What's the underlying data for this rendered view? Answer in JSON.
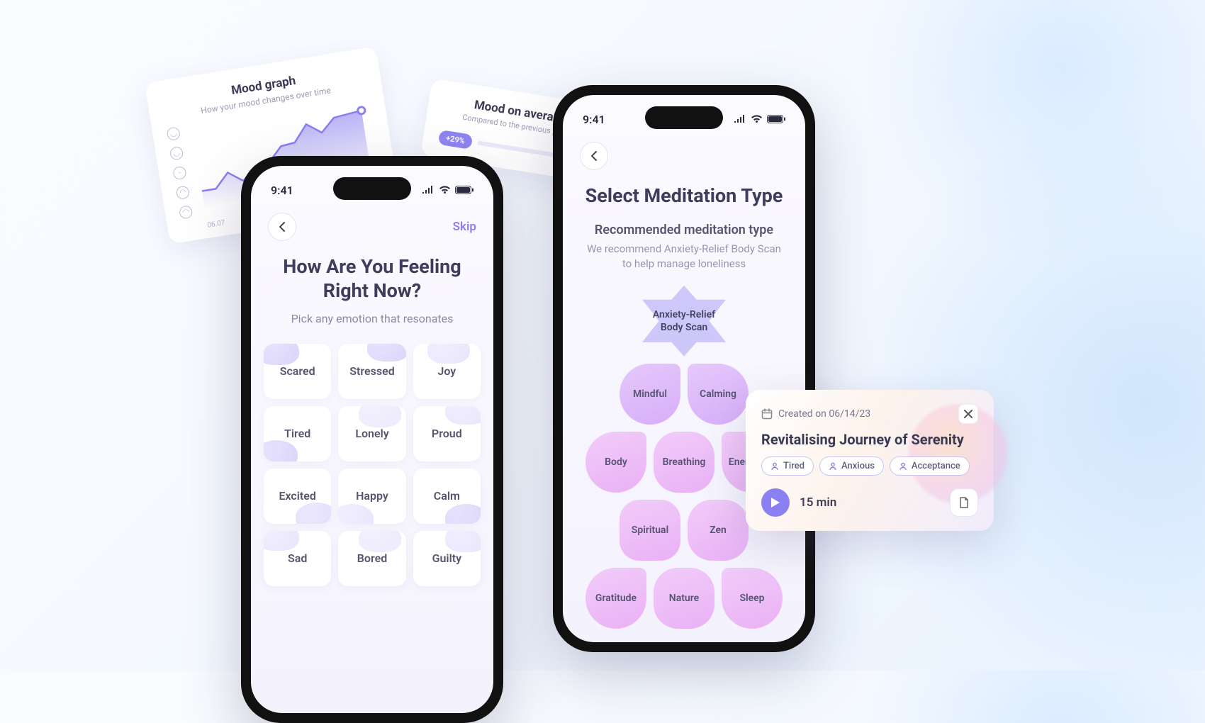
{
  "statusBar": {
    "time": "9:41"
  },
  "moodGraphCard": {
    "title": "Mood graph",
    "subtitle": "How your mood changes over time",
    "startDate": "06.07"
  },
  "moodAvgCard": {
    "title": "Mood on average",
    "subtitle": "Compared to the previous period",
    "delta": "+29%"
  },
  "phoneLeft": {
    "skip": "Skip",
    "heading": "How Are You Feeling Right Now?",
    "subtitle": "Pick any emotion that resonates",
    "emotions": {
      "e0": "Scared",
      "e1": "Stressed",
      "e2": "Joy",
      "e3": "Tired",
      "e4": "Lonely",
      "e5": "Proud",
      "e6": "Excited",
      "e7": "Happy",
      "e8": "Calm",
      "e9": "Sad",
      "e10": "Bored",
      "e11": "Guilty"
    }
  },
  "phoneRight": {
    "heading": "Select Meditation Type",
    "recommendLabel": "Recommended meditation type",
    "recommendDesc": "We recommend Anxiety-Relief Body Scan to help manage loneliness",
    "recommended": "Anxiety-Relief Body Scan",
    "types": {
      "t0": "Mindful",
      "t1": "Calming",
      "t2": "Body",
      "t3": "Breathing",
      "t4": "Energising",
      "t5": "Spiritual",
      "t6": "Zen",
      "t7": "Gratitude",
      "t8": "Nature",
      "t9": "Sleep"
    }
  },
  "sessionCard": {
    "createdLabel": "Created on 06/14/23",
    "title": "Revitalising Journey of Serenity",
    "tags": {
      "g0": "Tired",
      "g1": "Anxious",
      "g2": "Acceptance"
    },
    "duration": "15 min"
  },
  "chart_data": {
    "type": "line",
    "title": "Mood graph",
    "subtitle": "How your mood changes over time",
    "x_start_label": "06.07",
    "y_categories_ordinal": [
      "very_sad",
      "sad",
      "neutral",
      "happy",
      "very_happy"
    ],
    "x": [
      0,
      1,
      2,
      3,
      4,
      5,
      6,
      7,
      8,
      9,
      10,
      11,
      12
    ],
    "values_ordinal_index": [
      1,
      1,
      2,
      1,
      2,
      2,
      3,
      3,
      4,
      3,
      4,
      4,
      4
    ],
    "ylim": [
      0,
      4
    ]
  }
}
